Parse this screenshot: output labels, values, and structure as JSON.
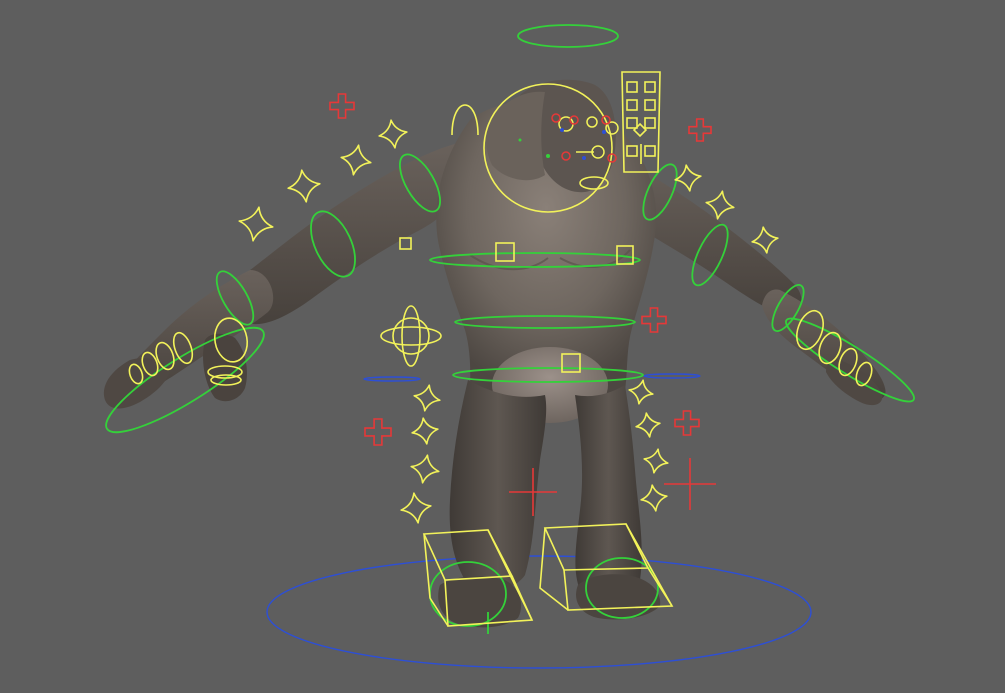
{
  "viewport": {
    "background": "#5e5e5e",
    "model": "creature-mesh",
    "control_colors": {
      "fk": "#f2f25a",
      "ik": "#34d13a",
      "locator": "#e63838",
      "world": "#2d4fd6"
    },
    "icons": [
      "star-control-icon",
      "cross-locator-icon",
      "cube-foot-control-icon",
      "circle-control-icon",
      "face-picker-panel-icon"
    ]
  }
}
